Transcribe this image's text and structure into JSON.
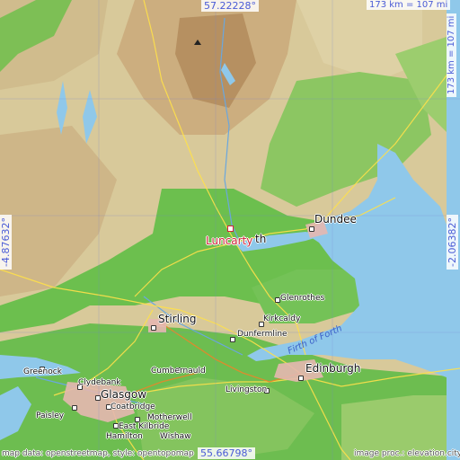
{
  "map": {
    "highlight": {
      "name": "Luncarty"
    },
    "coords": {
      "top": "57.22228°",
      "bottom": "55.66798°",
      "left": "-4.87632°",
      "right": "-2.06382°"
    },
    "scale": {
      "horizontal": "173 km = 107 mi",
      "vertical": "173 km = 107 mi"
    },
    "credits": {
      "left": "map data: openstreetmap, style: opentopomap",
      "right": "image proc.: elevation.city"
    },
    "places": {
      "perth_fragment": "th",
      "dundee": "Dundee",
      "stirling": "Stirling",
      "glenrothes": "Glenrothes",
      "kirkcaldy": "Kirkcaldy",
      "dunfermline": "Dunfermline",
      "edinburgh": "Edinburgh",
      "livingston": "Livingston",
      "cumbernauld": "Cumbernauld",
      "greenock": "Greenock",
      "clydebank": "Clydebank",
      "glasgow": "Glasgow",
      "paisley": "Paisley",
      "coatbridge": "Coatbridge",
      "motherwell": "Motherwell",
      "east_kilbride": "East Kilbride",
      "hamilton": "Hamilton",
      "wishaw": "Wishaw"
    },
    "water": {
      "firth_of_forth": "Firth of Forth"
    },
    "colors": {
      "sea": "#8fc8ea",
      "lowland": "#6cbf4e",
      "highland": "#d8c99a",
      "mountain": "#b89060",
      "highlight": "#d0243a",
      "coord_text": "#4a5bd6"
    }
  }
}
